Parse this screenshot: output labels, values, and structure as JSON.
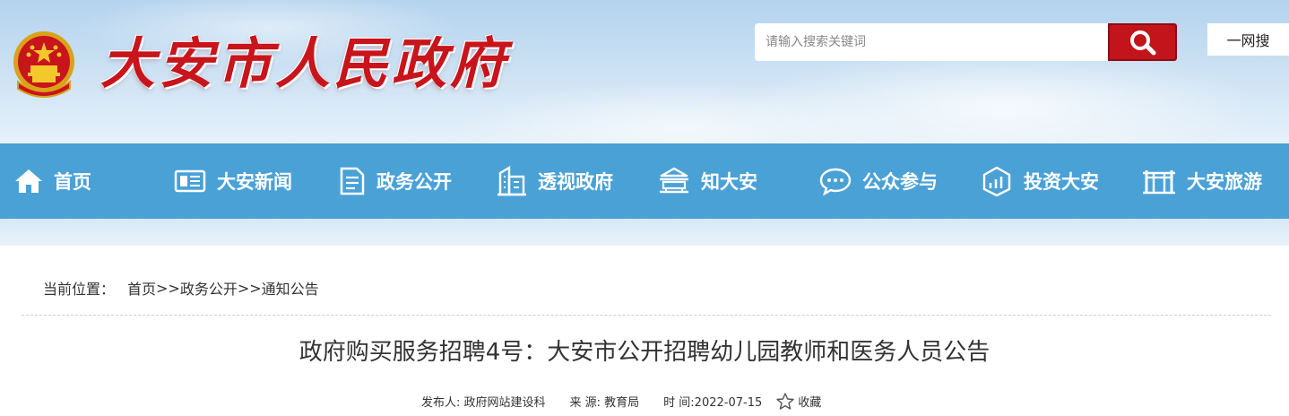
{
  "header": {
    "site_title": "大安市人民政府",
    "emblem_icon": "national-emblem",
    "search": {
      "placeholder": "请输入搜索关键词",
      "button_icon": "search-icon"
    },
    "one_search_label": "一网搜"
  },
  "nav": {
    "items": [
      {
        "label": "首页",
        "icon": "home-icon"
      },
      {
        "label": "大安新闻",
        "icon": "newspaper-icon"
      },
      {
        "label": "政务公开",
        "icon": "document-icon"
      },
      {
        "label": "透视政府",
        "icon": "building-icon"
      },
      {
        "label": "知大安",
        "icon": "pavilion-icon"
      },
      {
        "label": "公众参与",
        "icon": "chat-icon"
      },
      {
        "label": "投资大安",
        "icon": "chart-icon"
      },
      {
        "label": "大安旅游",
        "icon": "archway-icon"
      }
    ]
  },
  "breadcrumb": {
    "prefix": "当前位置：",
    "items": [
      "首页",
      "政务公开",
      "通知公告"
    ],
    "separator": ">>"
  },
  "article": {
    "title": "政府购买服务招聘4号：大安市公开招聘幼儿园教师和医务人员公告",
    "meta": {
      "publisher": "发布人: 政府网站建设科",
      "source": "来 源: 教育局",
      "time": "时 间:2022-07-15",
      "favorite_label": "收藏"
    }
  },
  "colors": {
    "brand_red": "#c8141b",
    "nav_blue": "#4aa1d6",
    "search_button": "#c2141a"
  }
}
